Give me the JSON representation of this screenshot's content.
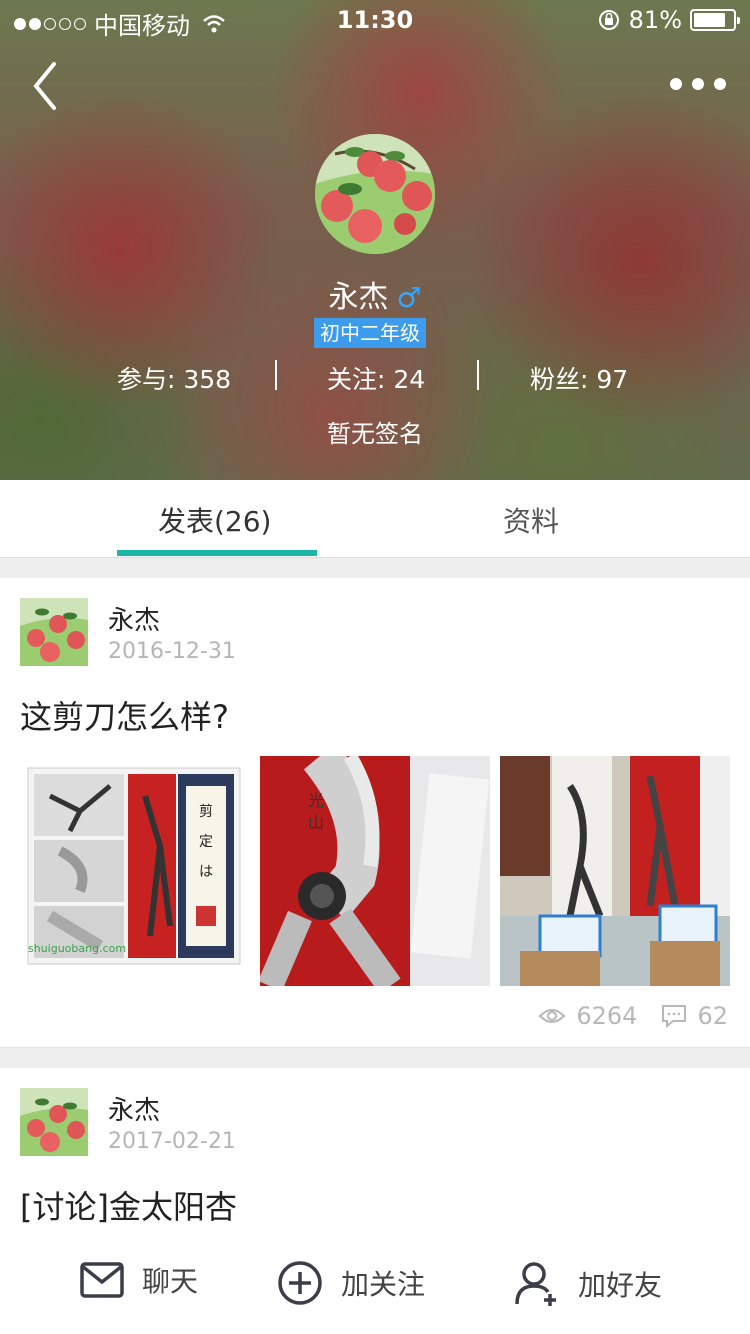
{
  "status_bar": {
    "carrier": "中国移动",
    "time": "11:30",
    "battery": "81%",
    "battery_level": 0.81
  },
  "profile": {
    "name": "永杰",
    "gender_symbol": "♂",
    "grade": "初中二年级",
    "stats": {
      "participate": "参与: 358",
      "following": "关注: 24",
      "fans": "粉丝: 97"
    },
    "signature": "暂无签名"
  },
  "tabs": [
    {
      "label": "发表(26)",
      "active": true
    },
    {
      "label": "资料",
      "active": false
    }
  ],
  "posts": [
    {
      "author": "永杰",
      "date": "2016-12-31",
      "title": "这剪刀怎么样?",
      "views": "6264",
      "comments": "62",
      "watermark": "shuiguobang.com"
    },
    {
      "author": "永杰",
      "date": "2017-02-21",
      "title": "[讨论]金太阳杏"
    }
  ],
  "actions": {
    "chat": "聊天",
    "follow": "加关注",
    "add_friend": "加好友"
  },
  "colors": {
    "accent": "#1bb6a5",
    "badge": "#3c9bea",
    "gender": "#35a6ff"
  }
}
